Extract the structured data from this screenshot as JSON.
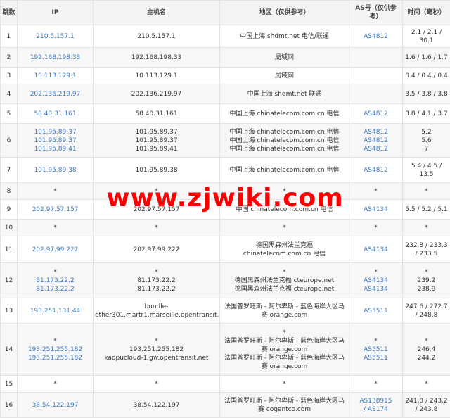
{
  "headers": {
    "hop": "跳数",
    "ip": "IP",
    "host": "主机名",
    "region": "地区（仅供参考）",
    "as": "AS号（仅供参考）",
    "time": "时间（毫秒）"
  },
  "rows": [
    {
      "hop": "1",
      "ip": [
        "210.5.157.1"
      ],
      "host": [
        "210.5.157.1"
      ],
      "region": [
        "中国上海 shdmt.net 电信/联通"
      ],
      "as": [
        "AS4812"
      ],
      "time": [
        "2.1 / 2.1 /",
        "30.1"
      ]
    },
    {
      "hop": "2",
      "ip": [
        "192.168.198.33"
      ],
      "host": [
        "192.168.198.33"
      ],
      "region": [
        "局域网"
      ],
      "as": [],
      "time": [
        "1.6 / 1.6 / 1.7"
      ]
    },
    {
      "hop": "3",
      "ip": [
        "10.113.129.1"
      ],
      "host": [
        "10.113.129.1"
      ],
      "region": [
        "局域网"
      ],
      "as": [],
      "time": [
        "0.4 / 0.4 / 0.4"
      ]
    },
    {
      "hop": "4",
      "ip": [
        "202.136.219.97"
      ],
      "host": [
        "202.136.219.97"
      ],
      "region": [
        "中国上海 shdmt.net 联通"
      ],
      "as": [],
      "time": [
        "3.5 / 3.8 / 3.8"
      ]
    },
    {
      "hop": "5",
      "ip": [
        "58.40.31.161"
      ],
      "host": [
        "58.40.31.161"
      ],
      "region": [
        "中国上海 chinatelecom.com.cn 电信"
      ],
      "as": [
        "AS4812"
      ],
      "time": [
        "3.8 / 4.1 / 3.7"
      ]
    },
    {
      "hop": "6",
      "ip": [
        "101.95.89.37",
        "101.95.89.37",
        "101.95.89.41"
      ],
      "host": [
        "101.95.89.37",
        "101.95.89.37",
        "101.95.89.41"
      ],
      "region": [
        "中国上海 chinatelecom.com.cn 电信",
        "中国上海 chinatelecom.com.cn 电信",
        "中国上海 chinatelecom.com.cn 电信"
      ],
      "as": [
        "AS4812",
        "AS4812",
        "AS4812"
      ],
      "time": [
        "5.2",
        "5.6",
        "7"
      ]
    },
    {
      "hop": "7",
      "ip": [
        "101.95.89.38"
      ],
      "host": [
        "101.95.89.38"
      ],
      "region": [
        "中国上海 chinatelecom.com.cn 电信"
      ],
      "as": [
        "AS4812"
      ],
      "time": [
        "5.4 / 4.5 /",
        "13.5"
      ]
    },
    {
      "hop": "8",
      "ip": [
        "*"
      ],
      "host": [
        "*"
      ],
      "region": [
        "*"
      ],
      "as": [
        "*"
      ],
      "time": [
        "*"
      ],
      "star": true
    },
    {
      "hop": "9",
      "ip": [
        "202.97.57.157"
      ],
      "host": [
        "202.97.57.157"
      ],
      "region": [
        "中国 chinatelecom.com.cn 电信"
      ],
      "as": [
        "AS4134"
      ],
      "time": [
        "5.5 / 5.2 / 5.1"
      ]
    },
    {
      "hop": "10",
      "ip": [
        "*"
      ],
      "host": [
        "*"
      ],
      "region": [
        "*"
      ],
      "as": [
        "*"
      ],
      "time": [
        "*"
      ],
      "star": true
    },
    {
      "hop": "11",
      "ip": [
        "202.97.99.222"
      ],
      "host": [
        "202.97.99.222"
      ],
      "region": [
        "德国黑森州法兰克福",
        "chinatelecom.com.cn 电信"
      ],
      "as": [
        "AS4134"
      ],
      "time": [
        "232.8 / 233.3",
        "/ 233.5"
      ]
    },
    {
      "hop": "12",
      "ip": [
        "*",
        "81.173.22.2",
        "81.173.22.2"
      ],
      "host": [
        "*",
        "81.173.22.2",
        "81.173.22.2"
      ],
      "region": [
        "*",
        "德国黑森州法兰克福 cteurope.net",
        "德国黑森州法兰克福 cteurope.net"
      ],
      "as": [
        "*",
        "AS4134",
        "AS4134"
      ],
      "time": [
        "*",
        "239.2",
        "238.9"
      ]
    },
    {
      "hop": "13",
      "ip": [
        "193.251.131.44"
      ],
      "host": [
        "bundle-",
        "ether301.martr1.marseille.opentransit.net"
      ],
      "region": [
        "法国普罗旺斯 - 阿尔卑斯 - 蓝色海岸大区马",
        "赛 orange.com"
      ],
      "as": [
        "AS5511"
      ],
      "time": [
        "247.6 / 272.7",
        "/ 248.8"
      ]
    },
    {
      "hop": "14",
      "ip": [
        "*",
        "193.251.255.182",
        "193.251.255.182"
      ],
      "host": [
        "*",
        "193.251.255.182",
        "kaopucloud-1.gw.opentransit.net"
      ],
      "region": [
        "*",
        "法国普罗旺斯 - 阿尔卑斯 - 蓝色海岸大区马",
        "赛 orange.com",
        "法国普罗旺斯 - 阿尔卑斯 - 蓝色海岸大区马",
        "赛 orange.com"
      ],
      "as": [
        "*",
        "AS5511",
        "AS5511"
      ],
      "time": [
        "*",
        "246.4",
        "244.2"
      ]
    },
    {
      "hop": "15",
      "ip": [
        "*"
      ],
      "host": [
        "*"
      ],
      "region": [
        "*"
      ],
      "as": [
        "*"
      ],
      "time": [
        "*"
      ],
      "star": true
    },
    {
      "hop": "16",
      "ip": [
        "38.54.122.197"
      ],
      "host": [
        "38.54.122.197"
      ],
      "region": [
        "法国普罗旺斯 - 阿尔卑斯 - 蓝色海岸大区马",
        "赛 cogentco.com"
      ],
      "as": [
        "AS138915",
        "/ AS174"
      ],
      "time": [
        "241.8 / 243.2",
        "/ 243.8"
      ]
    }
  ],
  "watermark": "www.zjwiki.com",
  "colors": {
    "link": "#3a78c3",
    "watermark": "#ff0000",
    "border": "#e3e3e3",
    "header_bg": "#f4f4f4"
  }
}
